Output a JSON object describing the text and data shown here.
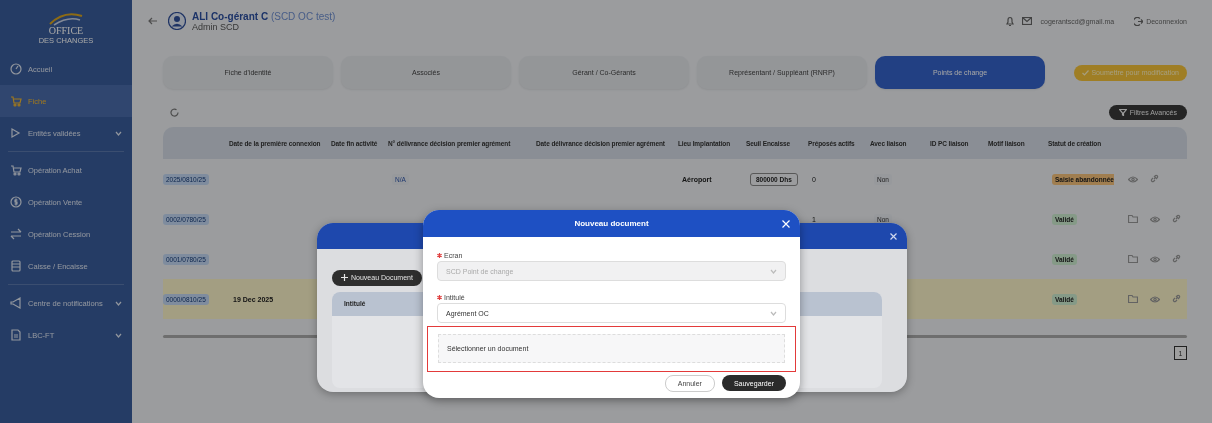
{
  "sidebar": {
    "logo": {
      "title": "OFFICE",
      "subtitle": "DES CHANGES"
    },
    "items": [
      {
        "kind": "link",
        "label": "Accueil",
        "selected": false
      },
      {
        "kind": "link",
        "label": "Fiche",
        "selected": true
      },
      {
        "kind": "group",
        "label": "Entités validées",
        "selected": false
      },
      {
        "kind": "divider"
      },
      {
        "kind": "link",
        "label": "Opération Achat",
        "selected": false
      },
      {
        "kind": "link",
        "label": "Opération Vente",
        "selected": false
      },
      {
        "kind": "link",
        "label": "Opération Cession",
        "selected": false
      },
      {
        "kind": "link",
        "label": "Caisse / Encaisse",
        "selected": false
      },
      {
        "kind": "divider"
      },
      {
        "kind": "group",
        "label": "Centre de notifications",
        "selected": false
      },
      {
        "kind": "group",
        "label": "LBC-FT",
        "selected": false
      }
    ]
  },
  "header": {
    "user_name": "**ALI Co-gérant C** (SCD OC test)",
    "user_role": "Admin SCD",
    "email": "cogerantscd@gmail.ma",
    "logout": "Deconnexion"
  },
  "tabs": [
    {
      "label": "Fiche d'identité",
      "selected": false
    },
    {
      "label": "Associés",
      "selected": false
    },
    {
      "label": "Gérant / Co-Gérants",
      "selected": false
    },
    {
      "label": "Représentant / Suppléant (RNRP)",
      "selected": false
    },
    {
      "label": "Points de change",
      "selected": true
    }
  ],
  "submit_button": "Soumettre pour modification",
  "filter_button": "Filtres Avancés",
  "table": {
    "columns": [
      null,
      "Date de la première connexion",
      "Date fin activité",
      "N° délivrance décision premier agrément",
      "Date délivrance décision premier agrément",
      "Lieu Implantation",
      "Seuil Encaisse",
      "Préposés actifs",
      "Avec liaison",
      "ID PC liaison",
      "Motif liaison",
      "Statut de création"
    ],
    "rows": [
      {
        "cells": [
          "2025/0810/25",
          null,
          null,
          "N/A",
          null,
          "Aéroport",
          "800000 Dhs",
          "0",
          "Non",
          null,
          null
        ],
        "status": "Saisie abandonnée",
        "color": "#a07e50",
        "has_documents": false,
        "highlighted": false
      },
      {
        "cells": [
          "0002/0780/25",
          null,
          null,
          null,
          null,
          null,
          null,
          "1",
          "Non",
          null,
          null
        ],
        "status": "Validé",
        "color": "#859a87",
        "has_documents": true,
        "highlighted": false
      },
      {
        "cells": [
          "0001/0780/25",
          null,
          null,
          null,
          null,
          null,
          null,
          null,
          null,
          null,
          null
        ],
        "status": "Validé",
        "color": "#859a87",
        "has_documents": true,
        "highlighted": false
      },
      {
        "cells": [
          "0000/0810/25",
          "19 Dec 2025",
          null,
          null,
          null,
          null,
          null,
          null,
          null,
          null,
          null
        ],
        "status": "Validé",
        "color": "#859a87",
        "has_documents": true,
        "highlighted": true
      }
    ]
  },
  "pagination": [
    {
      "label": "1",
      "selected": true
    }
  ],
  "documents_modal": {
    "new_button": "Nouveau Document",
    "columns": [
      "Intitulé"
    ]
  },
  "new_document_modal": {
    "title": "Nouveau document",
    "fields": [
      {
        "label": "Ecran",
        "required": true,
        "value": "SCD Point de change",
        "disabled": true
      },
      {
        "label": "Intitulé",
        "required": true,
        "value": "Agrément OC",
        "disabled": false
      }
    ],
    "upload": {
      "placeholder": "Sélectionner un document",
      "highlighted": true
    },
    "cancel_button": "Annuler",
    "save_button": "Sauvegarder"
  }
}
